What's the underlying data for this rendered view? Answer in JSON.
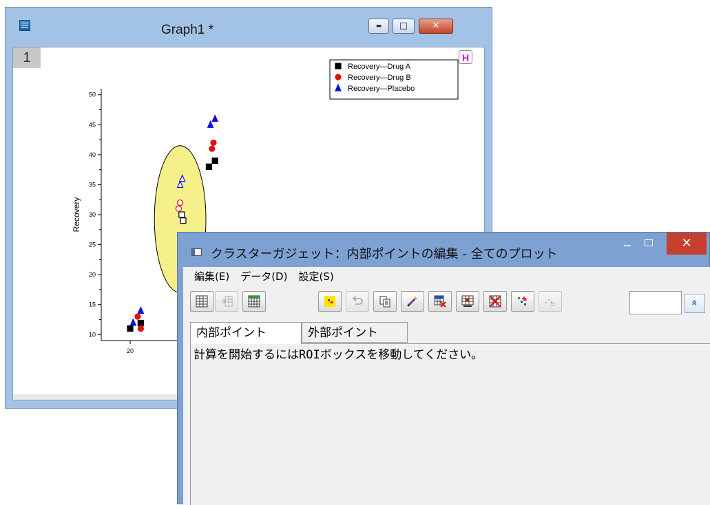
{
  "graph_window": {
    "title": "Graph1 *",
    "layer_badge": "1",
    "h_badge": "H",
    "buttons": {
      "minimize": "▬",
      "maximize": "□",
      "close": "✕"
    }
  },
  "chart_data": {
    "type": "scatter",
    "ylabel": "Recovery",
    "xlabel": "",
    "y_ticks": [
      "10",
      "15",
      "20",
      "25",
      "30",
      "35",
      "40",
      "45",
      "50"
    ],
    "x_ticks": [
      "20"
    ],
    "ylim": [
      9,
      51
    ],
    "xlim": [
      18,
      70
    ],
    "legend": {
      "placement": "top-right"
    },
    "series": [
      {
        "name": "Recovery—Drug A",
        "marker": "square",
        "color": "#000000",
        "points": [
          [
            20,
            11
          ],
          [
            23.5,
            11.9
          ],
          [
            37,
            30
          ],
          [
            37.5,
            29
          ],
          [
            46,
            38
          ],
          [
            48,
            39
          ]
        ]
      },
      {
        "name": "Recovery—Drug B",
        "marker": "circle",
        "color": "#e01010",
        "points": [
          [
            22.5,
            13
          ],
          [
            23.5,
            11
          ],
          [
            36,
            31
          ],
          [
            36.5,
            32
          ],
          [
            47,
            41
          ],
          [
            47.5,
            42
          ]
        ]
      },
      {
        "name": "Recovery—Placebo",
        "marker": "triangle",
        "color": "#1010e0",
        "points": [
          [
            21,
            12
          ],
          [
            23.5,
            14
          ],
          [
            36.5,
            35
          ],
          [
            37.2,
            36
          ],
          [
            46.5,
            45
          ],
          [
            48,
            46
          ]
        ]
      }
    ],
    "roi": {
      "shape": "ellipse",
      "fill": "#f5f08a",
      "x_range": [
        28,
        45
      ],
      "y_range": [
        17,
        41.5
      ]
    },
    "inside_points_style": "hollow"
  },
  "dialog": {
    "title": "クラスターガジェット：内部ポイントの編集 - 全てのプロット",
    "min_glyph": "−",
    "close_glyph": "✕",
    "menu": [
      "編集(E)",
      "データ(D)",
      "設定(S)"
    ],
    "toolbar_icons": [
      "worksheet-grid-icon",
      "add-to-worksheet-icon",
      "new-worksheet-icon",
      "mask-points-icon",
      "undo-icon",
      "copy-icon",
      "eraser-icon",
      "delete-rows-icon",
      "remove-outliers-icon",
      "clear-mask-icon",
      "cluster-plot-icon",
      "data-points-icon"
    ],
    "expand_glyph": "»",
    "tabs": [
      "内部ポイント",
      "外部ポイント"
    ],
    "message": "計算を開始するにはROIボックスを移動してください。"
  }
}
